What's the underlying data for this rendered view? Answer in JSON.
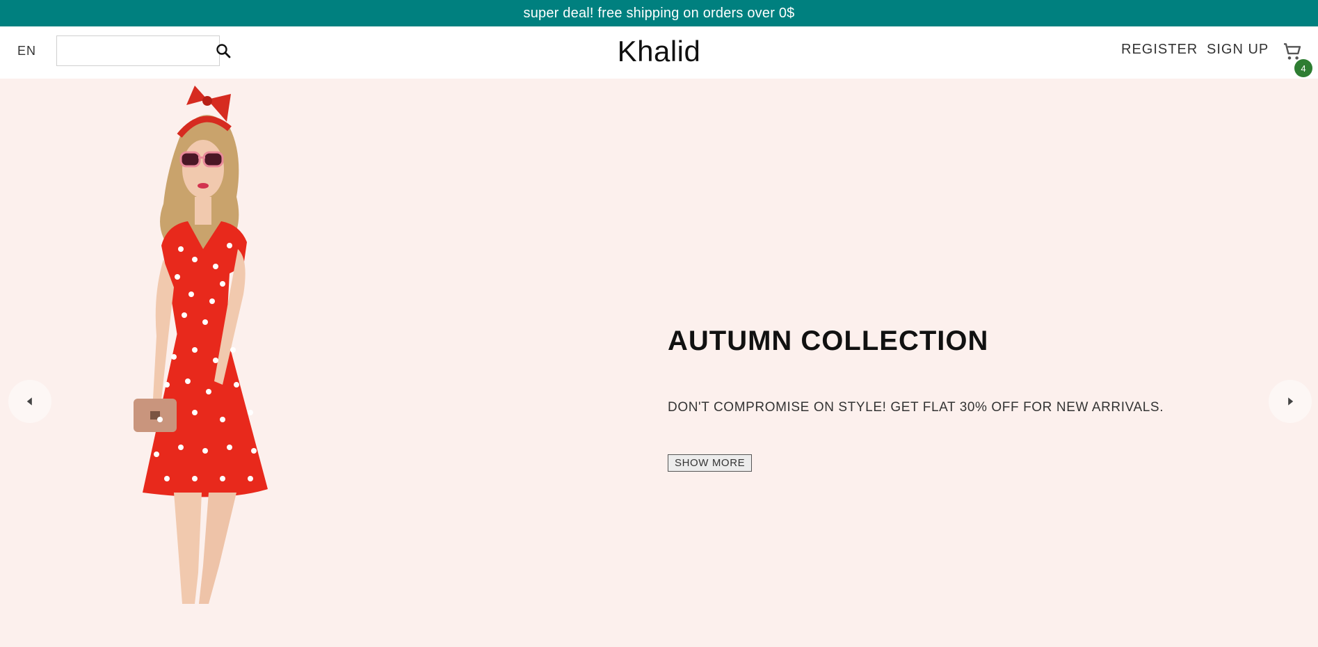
{
  "announcement": {
    "text": "super deal! free shipping on orders over 0$"
  },
  "navbar": {
    "language": "EN",
    "search": {
      "placeholder": "",
      "value": "",
      "icon": "search-icon"
    },
    "logo": "Khalid",
    "menu": {
      "register": "REGISTER",
      "sign_up": "SIGN UP"
    },
    "cart": {
      "icon": "cart-icon",
      "count": "4"
    }
  },
  "hero": {
    "title": "AUTUMN COLLECTION",
    "description": "DON'T COMPROMISE ON STYLE! GET FLAT 30% OFF FOR NEW ARRIVALS.",
    "button_label": "SHOW MORE",
    "prev_icon": "arrow-left-icon",
    "next_icon": "arrow-right-icon"
  },
  "colors": {
    "announce_bg": "#00807f",
    "hero_bg": "#fcf0ed",
    "badge": "#2e7d32",
    "dress_red": "#e8291c"
  }
}
